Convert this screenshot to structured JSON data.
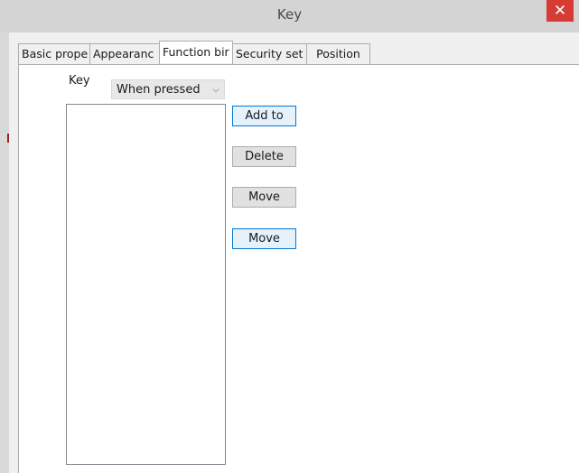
{
  "window": {
    "title": "Key",
    "close_glyph": "✕"
  },
  "tabs": [
    {
      "label": "Basic prope",
      "active": false
    },
    {
      "label": "Appearanc",
      "active": false
    },
    {
      "label": "Function bir",
      "active": true
    },
    {
      "label": "Security set",
      "active": false
    },
    {
      "label": "Position",
      "active": false
    }
  ],
  "function_binding": {
    "key_label": "Key",
    "trigger_select": {
      "value": "When pressed",
      "chevron": "⌵"
    },
    "buttons": {
      "add": "Add to",
      "delete": "Delete",
      "move_up": "Move",
      "move_down": "Move"
    }
  }
}
